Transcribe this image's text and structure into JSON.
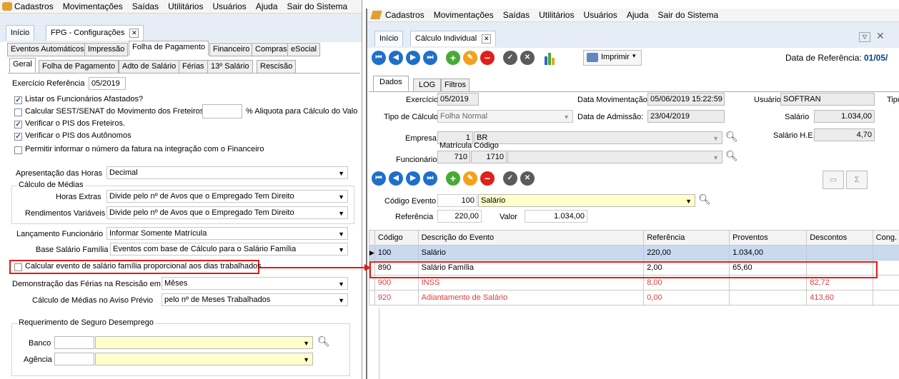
{
  "left": {
    "menu": [
      "Cadastros",
      "Movimentações",
      "Saídas",
      "Utilitários",
      "Usuários",
      "Ajuda",
      "Sair do Sistema"
    ],
    "tabs": [
      "Início",
      "FPG - Configurações"
    ],
    "main_tabs": [
      "Eventos Automáticos",
      "Impressão",
      "Folha de Pagamento",
      "Financeiro",
      "Compras",
      "eSocial"
    ],
    "sub_tabs": [
      "Geral",
      "Folha de Pagamento",
      "Adto de Salário",
      "Férias",
      "13º Salário",
      "Rescisão"
    ],
    "exercicio_label": "Exercício Referência",
    "exercicio_value": "05/2019",
    "checks": [
      {
        "label": "Listar os Funcionários Afastados?",
        "checked": "✓"
      },
      {
        "label": "Calcular SEST/SENAT do Movimento dos Freteiros",
        "checked": ""
      },
      {
        "label": "Verificar o PIS dos Freteiros.",
        "checked": "✓"
      },
      {
        "label": "Verificar o PIS dos Autônomos",
        "checked": "✓"
      },
      {
        "label": "Permitir informar o número da fatura na integração com o Financeiro",
        "checked": ""
      }
    ],
    "aliquota_label": "% Aliquota para Cálculo do Valo",
    "apresentacao_label": "Apresentação das Horas",
    "apresentacao_value": "Decimal",
    "calculo_medias_label": "Cálculo de Médias",
    "horas_extras_label": "Horas Extras",
    "horas_extras_value": "Divide pelo nº de Avos que o Empregado Tem Direito",
    "rend_var_label": "Rendimentos Variáveis",
    "rend_var_value": "Divide pelo nº de Avos que o Empregado Tem Direito",
    "lanc_func_label": "Lançamento Funcionário",
    "lanc_func_value": "Informar Somente Matrícula",
    "base_sal_label": "Base Salário Família",
    "base_sal_value": "Eventos com base de Cálculo para o Salário Família",
    "calc_evento_label": "Calcular evento de salário família proporcional aos dias trabalhados",
    "demo_ferias_label": "Demonstração das Férias na Rescisão em",
    "demo_ferias_value": "Mêses",
    "calc_aviso_label": "Cálculo de Médias no Aviso Prévio",
    "calc_aviso_value": "pelo nº de Meses Trabalhados",
    "req_seguro_label": "Requerimento de Seguro Desemprego",
    "banco_label": "Banco",
    "agencia_label": "Agência"
  },
  "right": {
    "menu": [
      "Cadastros",
      "Movimentações",
      "Saídas",
      "Utilitários",
      "Usuários",
      "Ajuda",
      "Sair do Sistema"
    ],
    "tabs": [
      "Início",
      "Cálculo Individual"
    ],
    "imprimir_label": "Imprimir",
    "data_ref_label": "Data de Referência:",
    "data_ref_value": "01/05/",
    "sub_tabs": [
      "Dados",
      "LOG",
      "Filtros"
    ],
    "exercicio_label": "Exercício",
    "exercicio_value": "05/2019",
    "data_mov_label": "Data Movimentação",
    "data_mov_value": "05/06/2019 15:22:59",
    "usuario_label": "Usuário:",
    "usuario_value": "SOFTRAN",
    "tipo_label": "Tipo",
    "tipo_calc_label": "Tipo de Cálculo",
    "tipo_calc_value": "Folha Normal",
    "data_adm_label": "Data de Admissão:",
    "data_adm_value": "23/04/2019",
    "salario_label": "Salário",
    "salario_value": "1.034,00",
    "empresa_label": "Empresa",
    "empresa_code": "1",
    "empresa_name": "BR",
    "salario_he_label": "Salário H.E.",
    "salario_he_value": "4,70",
    "matricula_label": "Matrícula",
    "codigo_label": "Código",
    "funcionario_label": "Funcionário",
    "matricula_value": "710",
    "codigo_value": "1710",
    "cod_evento_label": "Código Evento",
    "cod_evento_value": "100",
    "cod_evento_name": "Salário",
    "referencia_label": "Referência",
    "referencia_value": "220,00",
    "valor_label": "Valor",
    "valor_value": "1.034,00",
    "grid_headers": [
      "Código",
      "Descrição do Evento",
      "Referência",
      "Proventos",
      "Descontos",
      "Cong."
    ],
    "grid_rows": [
      {
        "codigo": "100",
        "descricao": "Salário",
        "referencia": "220,00",
        "proventos": "1.034,00",
        "descontos": "",
        "color": "#000000",
        "bg": "#c9d9f0"
      },
      {
        "codigo": "890",
        "descricao": "Salário Família",
        "referencia": "2,00",
        "proventos": "65,60",
        "descontos": "",
        "color": "#000000",
        "bg": "#ffffff"
      },
      {
        "codigo": "900",
        "descricao": "INSS",
        "referencia": "8,00",
        "proventos": "",
        "descontos": "82,72",
        "color": "#e23b3b",
        "bg": "#ffffff"
      },
      {
        "codigo": "920",
        "descricao": "Adiantamento de Salário",
        "referencia": "0,00",
        "proventos": "",
        "descontos": "413,60",
        "color": "#e23b3b",
        "bg": "#ffffff"
      }
    ]
  },
  "colors": {
    "highlight": "#e21b1b",
    "accent": "#1e6fc9"
  }
}
